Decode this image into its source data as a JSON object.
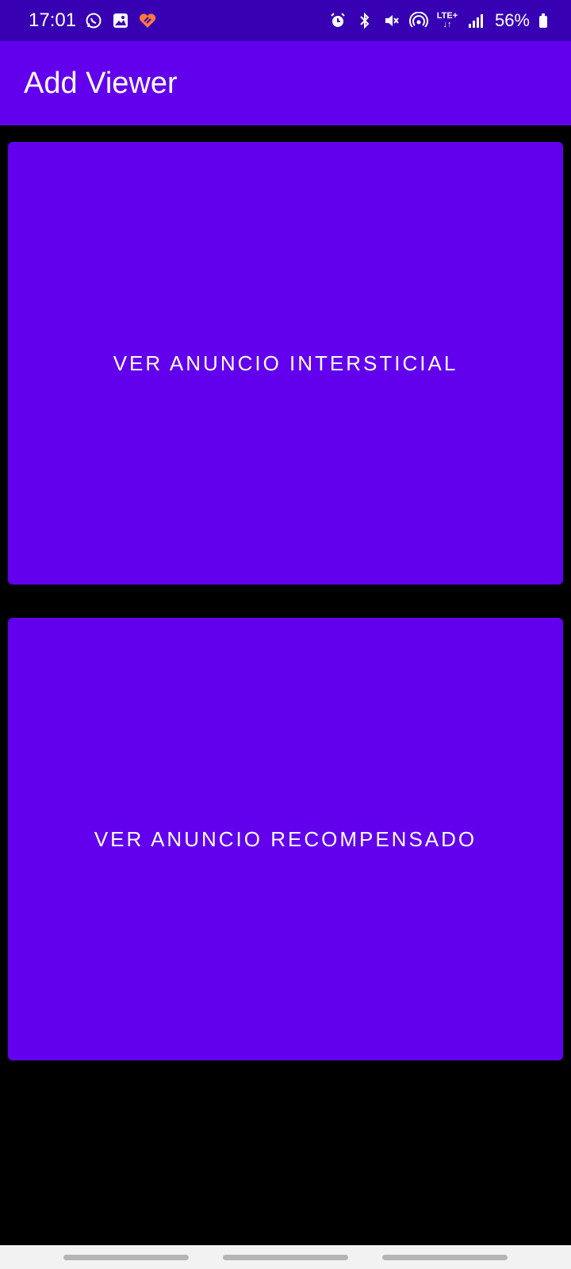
{
  "status_bar": {
    "time": "17:01",
    "left_icons": [
      "whatsapp-icon",
      "gallery-icon",
      "heart-app-icon"
    ],
    "right_icons": [
      "alarm-icon",
      "bluetooth-icon",
      "mute-icon",
      "hotspot-icon",
      "lte-icon",
      "signal-icon"
    ],
    "lte_label": "LTE+",
    "battery": "56%"
  },
  "app_bar": {
    "title": "Add Viewer",
    "color": "#6200ee"
  },
  "buttons": {
    "interstitial_label": "VER ANUNCIO INTERSTICIAL",
    "rewarded_label": "VER ANUNCIO RECOMPENSADO",
    "color": "#6200ee"
  },
  "theme": {
    "status_bar_color": "#3700b3",
    "background": "#000000"
  }
}
